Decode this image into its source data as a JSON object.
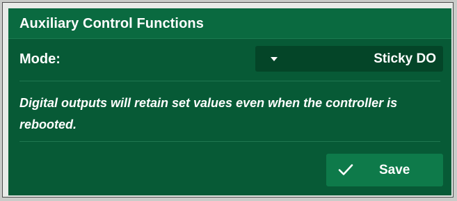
{
  "panel": {
    "title": "Auxiliary Control Functions",
    "mode_label": "Mode:",
    "mode_select": {
      "selected": "Sticky DO"
    },
    "description": "Digital outputs will retain set values even when the controller is rebooted.",
    "save_label": "Save"
  },
  "colors": {
    "panel_background": "#075a36",
    "header_background": "#0a6a40",
    "select_background": "#044528",
    "button_background": "#0e7a4a",
    "text": "#ffffff"
  },
  "icons": {
    "dropdown": "caret-down-icon",
    "save": "checkmark-icon"
  }
}
